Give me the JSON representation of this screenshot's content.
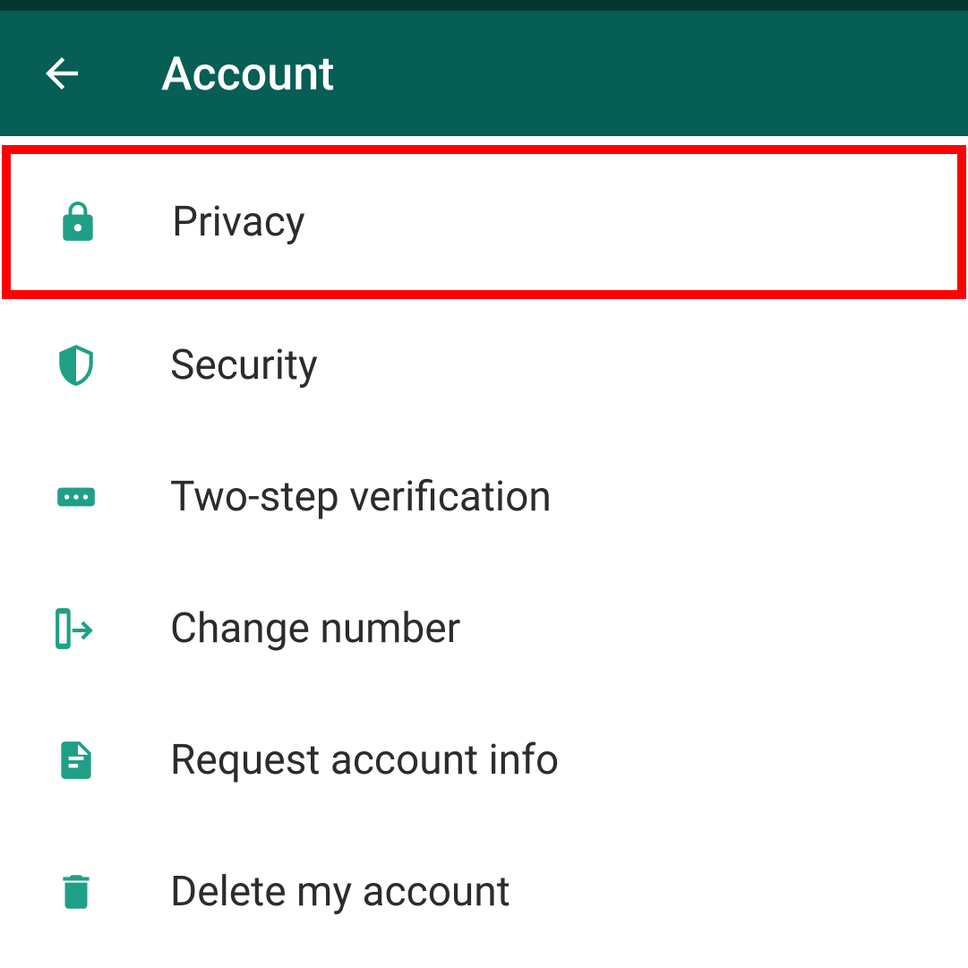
{
  "header": {
    "title": "Account"
  },
  "items": [
    {
      "label": "Privacy"
    },
    {
      "label": "Security"
    },
    {
      "label": "Two-step verification"
    },
    {
      "label": "Change number"
    },
    {
      "label": "Request account info"
    },
    {
      "label": "Delete my account"
    }
  ],
  "colors": {
    "brand": "#075E54",
    "accent": "#1fa086",
    "highlight_border": "#ff0000"
  }
}
